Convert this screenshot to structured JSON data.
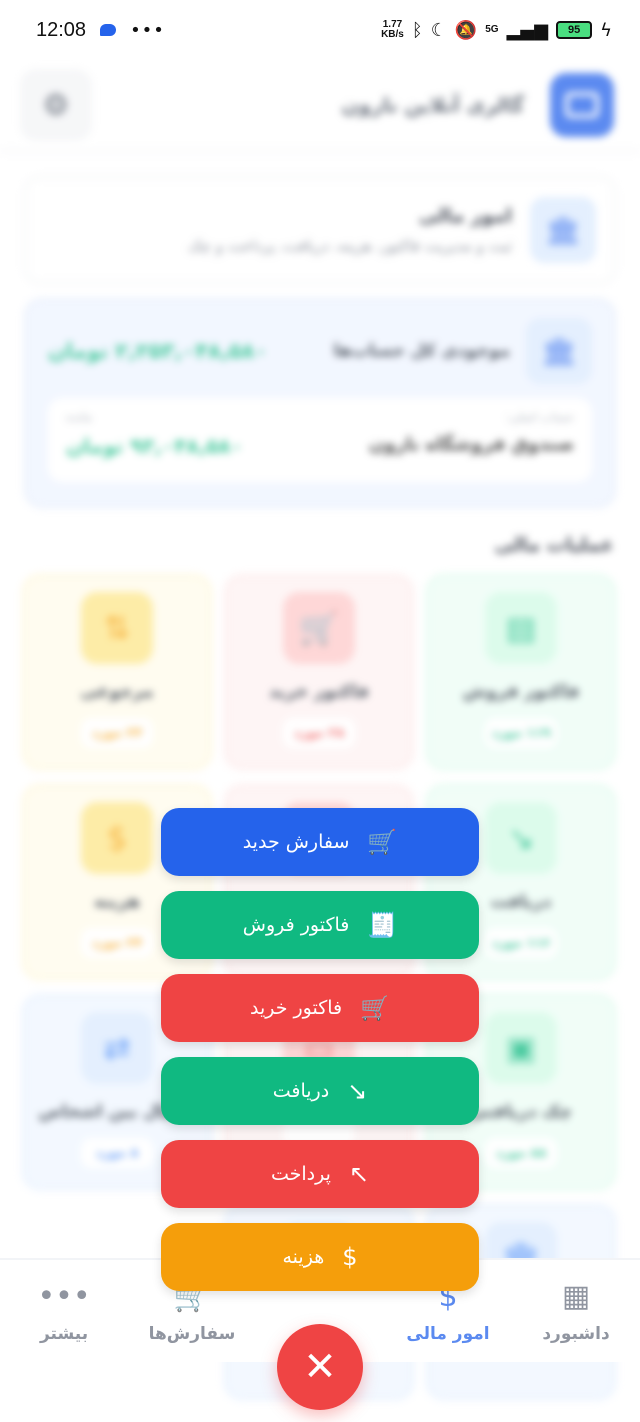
{
  "status_bar": {
    "time": "12:08",
    "net_speed_value": "1.77",
    "net_speed_unit": "KB/s",
    "network": "5G",
    "battery": "95"
  },
  "header": {
    "app_title": "گالری آنلاین نارون"
  },
  "finance_card": {
    "title": "امور مالی",
    "subtitle": "ثبت و مدیریت فاکتور، هزینه، دریافت، پرداخت و چک"
  },
  "balance": {
    "label": "موجودی کل حساب‌ها",
    "total": "۲,۲۵۳,۰۴۸,۵۸۰ تومان",
    "account_caption": "حساب اصلی:",
    "account_name": "صندوق فروشگاه نارون",
    "remain_caption": "مانده",
    "account_amount": "۹۳,۰۴۸,۵۸۰ تومان"
  },
  "operations_title": "عملیات مالی",
  "operations": [
    {
      "name": "فاکتور فروش",
      "count": "۱۱۹ مورد",
      "theme": "green",
      "icon": "receipt-icon"
    },
    {
      "name": "فاکتور خرید",
      "count": "۲۸ مورد",
      "theme": "red",
      "icon": "cart-icon"
    },
    {
      "name": "مرجوعی",
      "count": "۲۳ مورد",
      "theme": "orange",
      "icon": "swap-vertical-icon"
    },
    {
      "name": "دریافت",
      "count": "۱۱۶ مورد",
      "theme": "green",
      "icon": "arrow-down-right-icon"
    },
    {
      "name": "",
      "count": "",
      "theme": "red",
      "icon": "arrow-up-left-icon"
    },
    {
      "name": "هزینه",
      "count": "۲۴ مورد",
      "theme": "orange",
      "icon": "expense-icon"
    },
    {
      "name": "چک دریافتی",
      "count": "۸۸ مورد",
      "theme": "green",
      "icon": "cash-icon"
    },
    {
      "name": "",
      "count": "",
      "theme": "red",
      "icon": "cheque-icon"
    },
    {
      "name": "انتقال بین اشخاص",
      "count": "۸ مورد",
      "theme": "blue",
      "icon": "transfer-icon"
    }
  ],
  "fab_menu": [
    {
      "label": "سفارش جدید",
      "icon": "🛒",
      "color": "#2563eb"
    },
    {
      "label": "فاکتور فروش",
      "icon": "🧾",
      "color": "#10b981"
    },
    {
      "label": "فاکتور خرید",
      "icon": "🛒",
      "color": "#ef4444"
    },
    {
      "label": "دریافت",
      "icon": "↘",
      "color": "#10b981"
    },
    {
      "label": "پرداخت",
      "icon": "↖",
      "color": "#ef4444"
    },
    {
      "label": "هزینه",
      "icon": "$",
      "color": "#f59e0b"
    }
  ],
  "bottom_nav": {
    "dashboard": "داشبورد",
    "finance": "امور مالی",
    "orders": "سفارش‌ها",
    "more": "بیشتر"
  },
  "close_symbol": "✕"
}
